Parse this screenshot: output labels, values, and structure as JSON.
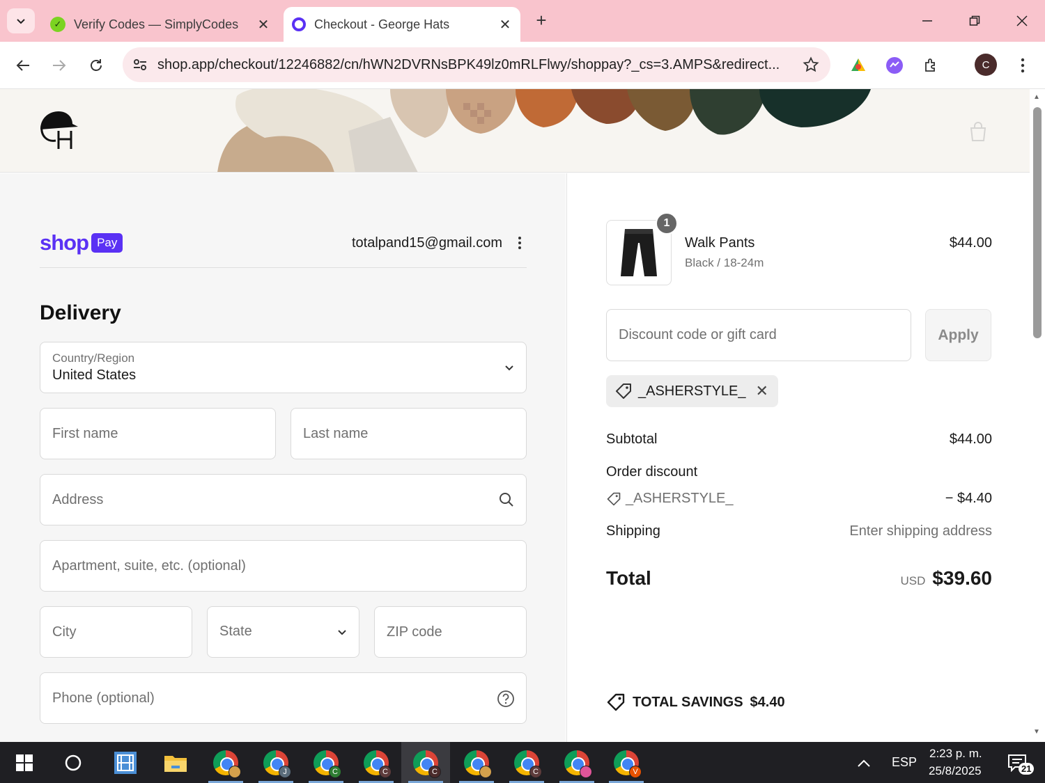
{
  "browser": {
    "tabs": [
      {
        "title": "Verify Codes — SimplyCodes",
        "active": false
      },
      {
        "title": "Checkout - George Hats",
        "active": true
      }
    ],
    "url": "shop.app/checkout/12246882/cn/hWN2DVRNsBPK49lz0mRLFlwy/shoppay?_cs=3.AMPS&redirect...",
    "profile_initial": "C"
  },
  "checkout": {
    "shoppay": {
      "brand": "shop",
      "pay_badge": "Pay"
    },
    "email": "totalpand15@gmail.com",
    "delivery_heading": "Delivery",
    "country": {
      "label": "Country/Region",
      "value": "United States"
    },
    "placeholders": {
      "first_name": "First name",
      "last_name": "Last name",
      "address": "Address",
      "apartment": "Apartment, suite, etc. (optional)",
      "city": "City",
      "state": "State",
      "zip": "ZIP code",
      "phone": "Phone (optional)"
    }
  },
  "summary": {
    "product": {
      "name": "Walk Pants",
      "variant": "Black / 18-24m",
      "price": "$44.00",
      "quantity": "1"
    },
    "discount_placeholder": "Discount code or gift card",
    "apply_label": "Apply",
    "applied_code": "_ASHERSTYLE_",
    "subtotal_label": "Subtotal",
    "subtotal_value": "$44.00",
    "order_discount_label": "Order discount",
    "discount_code": "_ASHERSTYLE_",
    "discount_value": "− $4.40",
    "shipping_label": "Shipping",
    "shipping_value": "Enter shipping address",
    "total_label": "Total",
    "currency": "USD",
    "total_value": "$39.60",
    "savings_label": "TOTAL SAVINGS",
    "savings_value": "$4.40"
  },
  "taskbar": {
    "language": "ESP",
    "time": "2:23 p. m.",
    "date": "25/8/2025",
    "notifications": "21",
    "chrome_profiles": [
      "",
      "J",
      "C",
      "C",
      "C",
      "",
      "C",
      "",
      "V"
    ]
  }
}
